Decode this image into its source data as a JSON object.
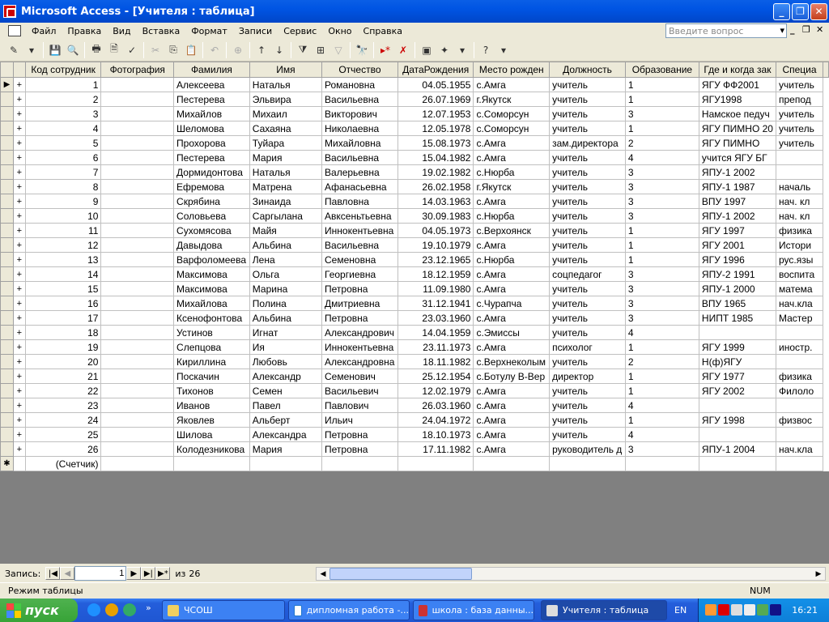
{
  "window": {
    "title": "Microsoft Access - [Учителя : таблица]"
  },
  "menu": {
    "items": [
      "Файл",
      "Правка",
      "Вид",
      "Вставка",
      "Формат",
      "Записи",
      "Сервис",
      "Окно",
      "Справка"
    ],
    "ask_placeholder": "Введите вопрос"
  },
  "table": {
    "columns": [
      "Код сотрудник",
      "Фотография",
      "Фамилия",
      "Имя",
      "Отчество",
      "ДатаРождения",
      "Место рожден",
      "Должность",
      "Образование",
      "Где и когда зак",
      "Специа"
    ],
    "rows": [
      [
        "1",
        "",
        "Алексеева",
        "Наталья",
        "Романовна",
        "04.05.1955",
        "с.Амга",
        "учитель",
        "1",
        "ЯГУ ФФ2001",
        "учитель"
      ],
      [
        "2",
        "",
        "Пестерева",
        "Эльвира",
        "Васильевна",
        "26.07.1969",
        "г.Якутск",
        "учитель",
        "1",
        "ЯГУ1998",
        "препод"
      ],
      [
        "3",
        "",
        "Михайлов",
        "Михаил",
        "Викторович",
        "12.07.1953",
        "с.Соморсун",
        "учитель",
        "3",
        "Намское педуч",
        "учитель"
      ],
      [
        "4",
        "",
        "Шеломова",
        "Сахаяна",
        "Николаевна",
        "12.05.1978",
        "с.Соморсун",
        "учитель",
        "1",
        "ЯГУ ПИМНО 20",
        "учитель"
      ],
      [
        "5",
        "",
        "Прохорова",
        "Туйара",
        "Михайловна",
        "15.08.1973",
        "с.Амга",
        "зам.директора",
        "2",
        "ЯГУ ПИМНО",
        "учитель"
      ],
      [
        "6",
        "",
        "Пестерева",
        "Мария",
        "Васильевна",
        "15.04.1982",
        "с.Амга",
        "учитель",
        "4",
        "учится ЯГУ БГ",
        ""
      ],
      [
        "7",
        "",
        "Дормидонтова",
        "Наталья",
        "Валерьевна",
        "19.02.1982",
        "с.Нюрба",
        "учитель",
        "3",
        "ЯПУ-1 2002",
        ""
      ],
      [
        "8",
        "",
        "Ефремова",
        "Матрена",
        "Афанасьевна",
        "26.02.1958",
        "г.Якутск",
        "учитель",
        "3",
        "ЯПУ-1 1987",
        "началь"
      ],
      [
        "9",
        "",
        "Скрябина",
        "Зинаида",
        "Павловна",
        "14.03.1963",
        "с.Амга",
        "учитель",
        "3",
        "ВПУ 1997",
        "нач. кл"
      ],
      [
        "10",
        "",
        "Соловьева",
        "Саргылана",
        "Авксеньтьевна",
        "30.09.1983",
        "с.Нюрба",
        "учитель",
        "3",
        "ЯПУ-1 2002",
        "нач. кл"
      ],
      [
        "11",
        "",
        "Сухомясова",
        "Майя",
        "Иннокентьевна",
        "04.05.1973",
        "с.Верхоянск",
        "учитель",
        "1",
        "ЯГУ 1997",
        "физика"
      ],
      [
        "12",
        "",
        "Давыдова",
        "Альбина",
        "Васильевна",
        "19.10.1979",
        "с.Амга",
        "учитель",
        "1",
        "ЯГУ 2001",
        "Истори"
      ],
      [
        "13",
        "",
        "Варфоломеева",
        "Лена",
        "Семеновна",
        "23.12.1965",
        "с.Нюрба",
        "учитель",
        "1",
        "ЯГУ 1996",
        "рус.язы"
      ],
      [
        "14",
        "",
        "Максимова",
        "Ольга",
        "Георгиевна",
        "18.12.1959",
        "с.Амга",
        "соцпедагог",
        "3",
        "ЯПУ-2 1991",
        "воспита"
      ],
      [
        "15",
        "",
        "Максимова",
        "Марина",
        "Петровна",
        "11.09.1980",
        "с.Амга",
        "учитель",
        "3",
        "ЯПУ-1 2000",
        "матема"
      ],
      [
        "16",
        "",
        "Михайлова",
        "Полина",
        "Дмитриевна",
        "31.12.1941",
        "с.Чурапча",
        "учитель",
        "3",
        "ВПУ 1965",
        "нач.кла"
      ],
      [
        "17",
        "",
        "Ксенофонтова",
        "Альбина",
        "Петровна",
        "23.03.1960",
        "с.Амга",
        "учитель",
        "3",
        "НИПТ 1985",
        "Мастер"
      ],
      [
        "18",
        "",
        "Устинов",
        "Игнат",
        "Александрович",
        "14.04.1959",
        "с.Эмиссы",
        "учитель",
        "4",
        "",
        ""
      ],
      [
        "19",
        "",
        "Слепцова",
        "Ия",
        "Иннокентьевна",
        "23.11.1973",
        "с.Амга",
        "психолог",
        "1",
        "ЯГУ 1999",
        "иностр."
      ],
      [
        "20",
        "",
        "Кириллина",
        "Любовь",
        "Александровна",
        "18.11.1982",
        "с.Верхнеколым",
        "учитель",
        "2",
        "Н(ф)ЯГУ",
        ""
      ],
      [
        "21",
        "",
        "Поскачин",
        "Александр",
        "Семенович",
        "25.12.1954",
        "с.Ботулу В-Вер",
        "директор",
        "1",
        "ЯГУ 1977",
        "физика"
      ],
      [
        "22",
        "",
        "Тихонов",
        "Семен",
        "Васильевич",
        "12.02.1979",
        "с.Амга",
        "учитель",
        "1",
        "ЯГУ 2002",
        "Филоло"
      ],
      [
        "23",
        "",
        "Иванов",
        "Павел",
        "Павлович",
        "26.03.1960",
        "с.Амга",
        "учитель",
        "4",
        "",
        ""
      ],
      [
        "24",
        "",
        "Яковлев",
        "Альберт",
        "Ильич",
        "24.04.1972",
        "с.Амга",
        "учитель",
        "1",
        "ЯГУ 1998",
        "физвос"
      ],
      [
        "25",
        "",
        "Шилова",
        "Александра",
        "Петровна",
        "18.10.1973",
        "с.Амга",
        "учитель",
        "4",
        "",
        ""
      ],
      [
        "26",
        "",
        "Колодезникова",
        "Мария",
        "Петровна",
        "17.11.1982",
        "с.Амга",
        "руководитель д",
        "3",
        "ЯПУ-1 2004",
        "нач.кла"
      ]
    ],
    "new_row_placeholder": "(Счетчик)"
  },
  "record_nav": {
    "label": "Запись:",
    "current": "1",
    "of_label": "из",
    "total": "26"
  },
  "status": {
    "mode": "Режим таблицы",
    "num": "NUM"
  },
  "taskbar": {
    "start_label": "пуск",
    "tasks": [
      "ЧСОШ",
      "дипломная работа -...",
      "школа : база данны...",
      "Учителя : таблица"
    ],
    "lang": "EN",
    "clock": "16:21"
  }
}
